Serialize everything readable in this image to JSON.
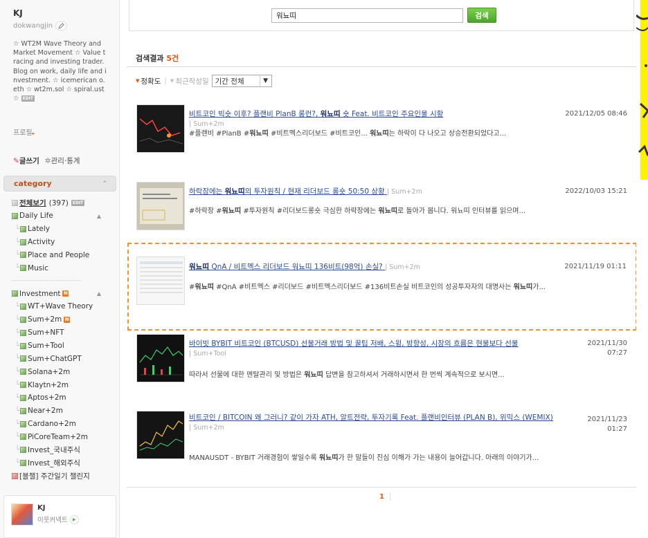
{
  "profile": {
    "name": "KJ",
    "id": "dokwangjin",
    "description": "☆ WT2M Wave Theory and Market Movement ☆ Value tracing and investing trader. Blog on work, daily life and investment. ☆ icemerican o.eth ☆ wt2m.sol ☆ spiral.ust ☆",
    "edit_tag": "EDIT",
    "profile_link": "프로필"
  },
  "actions": {
    "write": "글쓰기",
    "manage": "관리·통계"
  },
  "category": {
    "header": "category",
    "all": {
      "label": "전체보기",
      "count": "(397)",
      "tag": "EDIT"
    },
    "groups": [
      {
        "label": "Daily Life",
        "items": [
          "Lately",
          "Activity",
          "Place and People",
          "Music"
        ]
      },
      {
        "label": "Investment",
        "new": "N",
        "items": [
          "WT+Wave Theory",
          "Sum+2m",
          "Sum+NFT",
          "Sum+Tool",
          "Sum+ChatGPT",
          "Solana+2m",
          "Klaytn+2m",
          "Aptos+2m",
          "Near+2m",
          "Cardano+2m",
          "PiCoreTeam+2m",
          "Invest_국내주식",
          "Invest_해외주식"
        ]
      }
    ],
    "closed": "[블챌] 주간일기 챌린지"
  },
  "neighbor": {
    "name": "KJ",
    "sub": "이웃커넥트"
  },
  "search": {
    "query": "워뇨띠",
    "button": "검색"
  },
  "results": {
    "label": "검색결과",
    "count": "5건",
    "sort_accuracy": "정확도",
    "sort_recent": "최근작성일",
    "period": "기간 전체",
    "page": "1"
  },
  "posts": [
    {
      "title_pre": "비트코인 빅숏 이후? 플랜비 PlanB 롱런?, ",
      "title_kw": "워뇨띠",
      "title_post": " 숏 Feat. 비트코인 주요인물 시황",
      "category": "Sum+2m",
      "date": "2021/12/05 08:46",
      "snippet_pre": "#플랜비 #PlanB #",
      "snippet_kw": "워뇨띠",
      "snippet_mid": " #비트멕스리더보드 #비트코인... ",
      "snippet_kw2": "워뇨띠",
      "snippet_post": "는 하락이 다 나오고 상승전환되었다고..."
    },
    {
      "title_pre": "하락장에는 ",
      "title_kw": "워뇨띠",
      "title_post": "의 투자원칙 / 현재 리더보드 롱숏 50:50 상황",
      "category": "Sum+2m",
      "date": "2022/10/03 15:21",
      "snippet_pre": "#하락장 #",
      "snippet_kw": "워뇨띠",
      "snippet_mid": " #투자원칙 #리더보드롱숏 극심한 하락장에는 ",
      "snippet_kw2": "워뇨띠",
      "snippet_post": "로 돌아가 봅니다. 워뇨띠 인터뷰를 읽으며..."
    },
    {
      "title_pre": "",
      "title_kw": "워뇨띠",
      "title_post": " QnA / 비트멕스 리더보드 워뇨띠 136비트(98억) 손실?",
      "category": "Sum+2m",
      "date": "2021/11/19 01:11",
      "snippet_pre": "#",
      "snippet_kw": "워뇨띠",
      "snippet_mid": " #QnA #비트멕스 #리더보드 #비트멕스리더보드 #136비트손실 비트코인의 성공투자자의 대명사는 ",
      "snippet_kw2": "워뇨띠",
      "snippet_post": "가..."
    },
    {
      "title_pre": "바이빗 BYBIT 비트코인 (BTCUSD) 선물거래 방법 및 꿀팁 저배, 스윙, 방향성, 시장의 흐름은 현물보다 선물",
      "title_kw": "",
      "title_post": "",
      "category": "Sum+Tool",
      "date": "2021/11/30 07:27",
      "snippet_pre": "따라서 선물에 대한 멘탈관리 및 방법은 ",
      "snippet_kw": "워뇨띠",
      "snippet_mid": " 답변을 참고하셔서 거래하시면서 한 번씩 계속적으로 보시면...",
      "snippet_kw2": "",
      "snippet_post": ""
    },
    {
      "title_pre": "비트코인 / BITCOIN 왜 그러니? 같이 가자 ATH, 알트전략, 투자기록 Feat. 플랜비인터뷰 (PLAN B), 위믹스 (WEMIX)",
      "title_kw": "",
      "title_post": "",
      "category": "Sum+2m",
      "date": "2021/11/23 01:27",
      "snippet_pre": "MANAUSDT - BYBIT 거래경험이 쌓일수록 ",
      "snippet_kw": "워뇨띠",
      "snippet_mid": "가 한 말들이 진심 이해가 가는 내용이 늘어갑니다. 아래의 이야기가...",
      "snippet_kw2": "",
      "snippet_post": ""
    }
  ]
}
